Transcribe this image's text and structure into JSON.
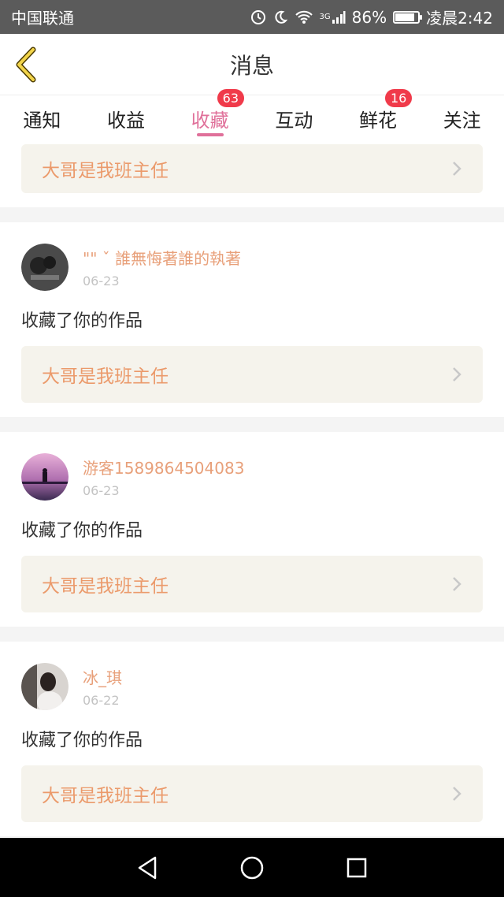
{
  "status_bar": {
    "carrier": "中国联通",
    "network": "3G",
    "battery": "86%",
    "time": "凌晨2:42"
  },
  "header": {
    "title": "消息"
  },
  "tabs": [
    {
      "label": "通知",
      "badge": ""
    },
    {
      "label": "收益",
      "badge": ""
    },
    {
      "label": "收藏",
      "badge": "63",
      "active": true
    },
    {
      "label": "互动",
      "badge": ""
    },
    {
      "label": "鲜花",
      "badge": "16"
    },
    {
      "label": "关注",
      "badge": ""
    }
  ],
  "top_partial_work": "大哥是我班主任",
  "items": [
    {
      "user": "\"\" ˇ 誰無悔著誰的執著",
      "date": "06-23",
      "action": "收藏了你的作品",
      "work": "大哥是我班主任"
    },
    {
      "user": "游客1589864504083",
      "date": "06-23",
      "action": "收藏了你的作品",
      "work": "大哥是我班主任"
    },
    {
      "user": "冰_琪",
      "date": "06-22",
      "action": "收藏了你的作品",
      "work": "大哥是我班主任"
    }
  ],
  "colors": {
    "accent": "#e0709a",
    "badge": "#f03a4a",
    "username": "#e8a07a",
    "work_title": "#eb9a6b"
  }
}
